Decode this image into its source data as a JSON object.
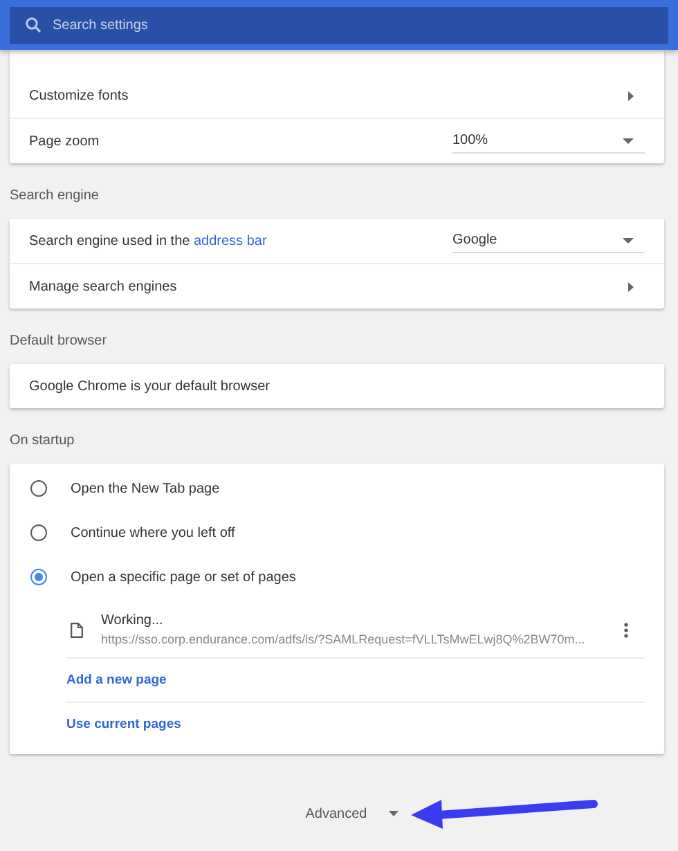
{
  "search": {
    "placeholder": "Search settings"
  },
  "appearance": {
    "rows": [
      {
        "kind": "link",
        "label": "Customize fonts"
      },
      {
        "kind": "select",
        "label": "Page zoom",
        "value": "100%"
      }
    ]
  },
  "sections": [
    {
      "title": "Search engine",
      "rows": [
        {
          "kind": "select",
          "label": "Search engine used in the",
          "link": "address bar",
          "value": "Google"
        },
        {
          "kind": "link",
          "label": "Manage search engines"
        }
      ]
    },
    {
      "title": "Default browser",
      "rows": [
        {
          "kind": "text",
          "label": "Google Chrome is your default browser"
        }
      ]
    }
  ],
  "startup": {
    "title": "On startup",
    "options": [
      {
        "label": "Open the New Tab page",
        "selected": false
      },
      {
        "label": "Continue where you left off",
        "selected": false
      },
      {
        "label": "Open a specific page or set of pages",
        "selected": true
      }
    ],
    "pages": [
      {
        "title": "Working...",
        "url": "https://sso.corp.endurance.com/adfs/ls/?SAMLRequest=fVLLTsMwELwj8Q%2BW70m..."
      }
    ],
    "actions": [
      "Add a new page",
      "Use current pages"
    ]
  },
  "advanced": {
    "label": "Advanced"
  }
}
